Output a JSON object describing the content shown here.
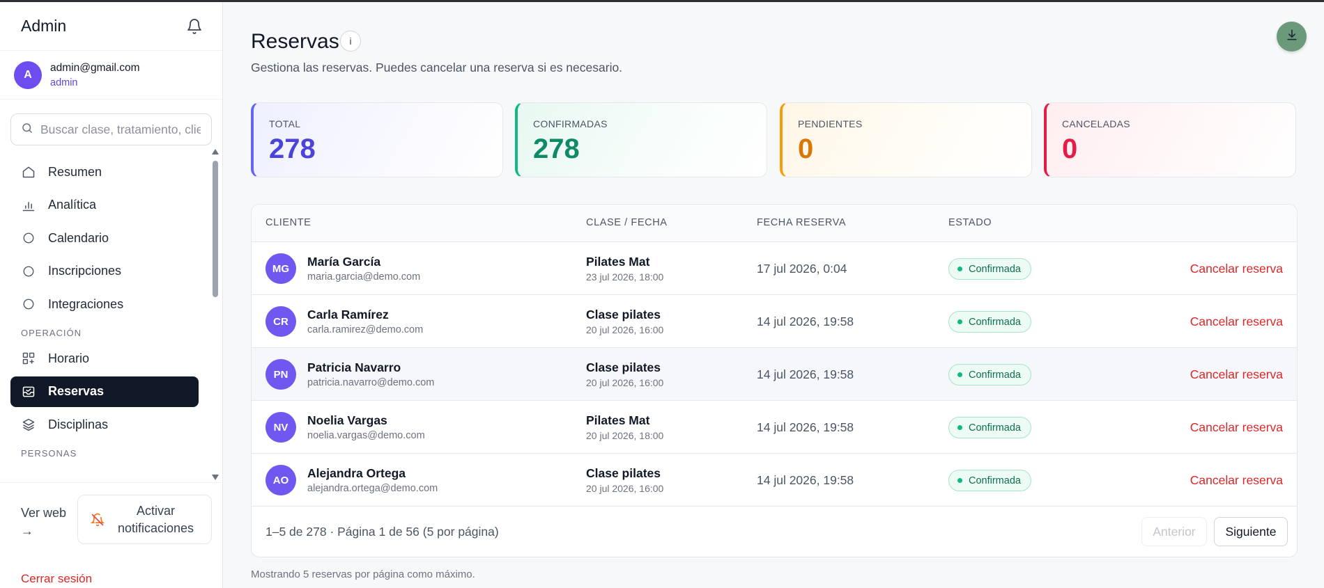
{
  "sidebar": {
    "brand": "Admin",
    "bell_icon": "bell-icon",
    "user": {
      "initial": "A",
      "email": "admin@gmail.com",
      "role": "admin"
    },
    "search_placeholder": "Buscar clase, tratamiento, clie",
    "items": [
      {
        "label": "Resumen",
        "icon": "home-icon"
      },
      {
        "label": "Analítica",
        "icon": "bar-chart-icon"
      },
      {
        "label": "Calendario",
        "icon": "circle-icon"
      },
      {
        "label": "Inscripciones",
        "icon": "circle-icon"
      },
      {
        "label": "Integraciones",
        "icon": "circle-icon"
      }
    ],
    "section_operacion": "OPERACIÓN",
    "operacion_items": [
      {
        "label": "Horario",
        "icon": "grid-plus-icon"
      },
      {
        "label": "Reservas",
        "icon": "inbox-icon",
        "active": true
      },
      {
        "label": "Disciplinas",
        "icon": "layers-icon"
      }
    ],
    "section_personas": "PERSONAS",
    "ver_web": "Ver web →",
    "notif_button": "Activar notificaciones",
    "logout": "Cerrar sesión"
  },
  "main": {
    "title": "Reservas",
    "info_label": "i",
    "subtitle": "Gestiona las reservas. Puedes cancelar una reserva si es necesario.",
    "stats": [
      {
        "label": "TOTAL",
        "value": "278",
        "color": "#4c44d8"
      },
      {
        "label": "CONFIRMADAS",
        "value": "278",
        "color": "#0f8a66"
      },
      {
        "label": "PENDIENTES",
        "value": "0",
        "color": "#d97706"
      },
      {
        "label": "CANCELADAS",
        "value": "0",
        "color": "#e11d48"
      }
    ],
    "table": {
      "headers": [
        "CLIENTE",
        "CLASE / FECHA",
        "FECHA RESERVA",
        "ESTADO"
      ],
      "rows": [
        {
          "initials": "MG",
          "name": "María García",
          "email": "maria.garcia@demo.com",
          "clase": "Pilates Mat",
          "fecha": "23 jul 2026, 18:00",
          "reserva": "17 jul 2026, 0:04",
          "estado": "Confirmada",
          "action": "Cancelar reserva"
        },
        {
          "initials": "CR",
          "name": "Carla Ramírez",
          "email": "carla.ramirez@demo.com",
          "clase": "Clase pilates",
          "fecha": "20 jul 2026, 16:00",
          "reserva": "14 jul 2026, 19:58",
          "estado": "Confirmada",
          "action": "Cancelar reserva"
        },
        {
          "initials": "PN",
          "name": "Patricia Navarro",
          "email": "patricia.navarro@demo.com",
          "clase": "Clase pilates",
          "fecha": "20 jul 2026, 16:00",
          "reserva": "14 jul 2026, 19:58",
          "estado": "Confirmada",
          "action": "Cancelar reserva"
        },
        {
          "initials": "NV",
          "name": "Noelia Vargas",
          "email": "noelia.vargas@demo.com",
          "clase": "Pilates Mat",
          "fecha": "20 jul 2026, 18:00",
          "reserva": "14 jul 2026, 19:58",
          "estado": "Confirmada",
          "action": "Cancelar reserva"
        },
        {
          "initials": "AO",
          "name": "Alejandra Ortega",
          "email": "alejandra.ortega@demo.com",
          "clase": "Clase pilates",
          "fecha": "20 jul 2026, 16:00",
          "reserva": "14 jul 2026, 19:58",
          "estado": "Confirmada",
          "action": "Cancelar reserva"
        }
      ],
      "page_info": "1–5 de 278 · Página 1 de 56 (5 por página)",
      "prev_label": "Anterior",
      "next_label": "Siguiente"
    },
    "note": "Mostrando 5 reservas por página como máximo."
  }
}
